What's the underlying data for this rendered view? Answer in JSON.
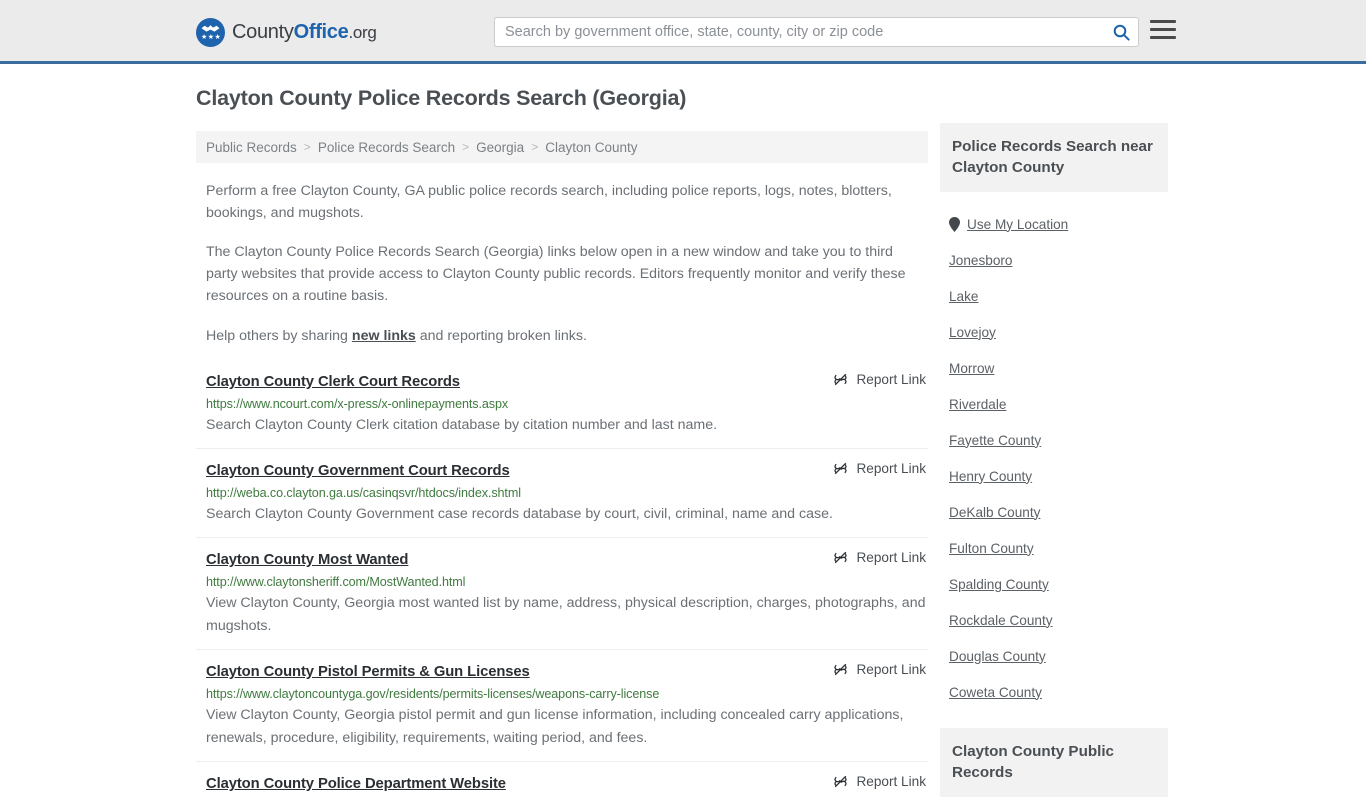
{
  "header": {
    "logo": {
      "part1": "County",
      "part2": "Office",
      "part3": ".org",
      "badge_icon": "eagle-badge-icon",
      "stars": "★★★"
    },
    "search": {
      "placeholder": "Search by government office, state, county, city or zip code",
      "value": "",
      "search_icon": "search-icon"
    },
    "menu_icon": "hamburger-menu-icon"
  },
  "main": {
    "title": "Clayton County Police Records Search (Georgia)",
    "breadcrumb": [
      "Public Records",
      "Police Records Search",
      "Georgia",
      "Clayton County"
    ],
    "breadcrumb_separator": ">",
    "intro": {
      "p1": "Perform a free Clayton County, GA public police records search, including police reports, logs, notes, blotters, bookings, and mugshots.",
      "p2": "The Clayton County Police Records Search (Georgia) links below open in a new window and take you to third party websites that provide access to Clayton County public records. Editors frequently monitor and verify these resources on a routine basis.",
      "p3_before": "Help others by sharing ",
      "p3_link": "new links",
      "p3_after": " and reporting broken links."
    },
    "report_link_label": "Report Link",
    "report_link_icon": "broken-link-icon",
    "results": [
      {
        "title": "Clayton County Clerk Court Records",
        "url": "https://www.ncourt.com/x-press/x-onlinepayments.aspx",
        "description": "Search Clayton County Clerk citation database by citation number and last name."
      },
      {
        "title": "Clayton County Government Court Records",
        "url": "http://weba.co.clayton.ga.us/casinqsvr/htdocs/index.shtml",
        "description": "Search Clayton County Government case records database by court, civil, criminal, name and case."
      },
      {
        "title": "Clayton County Most Wanted",
        "url": "http://www.claytonsheriff.com/MostWanted.html",
        "description": "View Clayton County, Georgia most wanted list by name, address, physical description, charges, photographs, and mugshots."
      },
      {
        "title": "Clayton County Pistol Permits & Gun Licenses",
        "url": "https://www.claytoncountyga.gov/residents/permits-licenses/weapons-carry-license",
        "description": "View Clayton County, Georgia pistol permit and gun license information, including concealed carry applications, renewals, procedure, eligibility, requirements, waiting period, and fees."
      },
      {
        "title": "Clayton County Police Department Website",
        "url": "",
        "description": ""
      }
    ]
  },
  "sidebar": {
    "panel_title": "Police Records Search near Clayton County",
    "use_my_location": "Use My Location",
    "location_icon": "map-pin-icon",
    "links": [
      "Jonesboro",
      "Lake",
      "Lovejoy",
      "Morrow",
      "Riverdale",
      "Fayette County",
      "Henry County",
      "DeKalb County",
      "Fulton County",
      "Spalding County",
      "Rockdale County",
      "Douglas County",
      "Coweta County"
    ],
    "panel2_title": "Clayton County Public Records"
  },
  "colors": {
    "brand_blue": "#1e63ad",
    "header_border": "#3a6d9e",
    "url_green": "#3f7a3f",
    "panel_gray": "#f2f2f2"
  }
}
